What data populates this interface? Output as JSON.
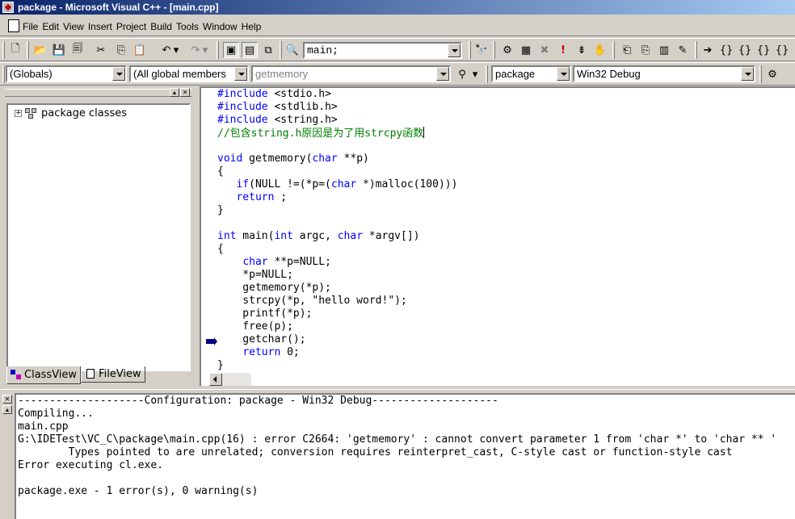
{
  "title": "package - Microsoft Visual C++ - [main.cpp]",
  "menu": [
    "File",
    "Edit",
    "View",
    "Insert",
    "Project",
    "Build",
    "Tools",
    "Window",
    "Help"
  ],
  "toolbar": {
    "find_combo": "main;"
  },
  "wizard_bar": {
    "scope": "(Globals)",
    "members": "(All global members",
    "function": "getmemory",
    "project": "package",
    "config": "Win32 Debug"
  },
  "workspace": {
    "tree_root": "package classes",
    "tabs": [
      "ClassView",
      "FileView"
    ]
  },
  "editor": {
    "lines": [
      [
        {
          "t": "#include",
          "c": "kw"
        },
        {
          "t": " <stdio.h>"
        }
      ],
      [
        {
          "t": "#include",
          "c": "kw"
        },
        {
          "t": " <stdlib.h>"
        }
      ],
      [
        {
          "t": "#include",
          "c": "kw"
        },
        {
          "t": " <string.h>"
        }
      ],
      [
        {
          "t": "//包含string.h原因是为了用strcpy函数",
          "c": "cm"
        }
      ],
      [],
      [
        {
          "t": "void",
          "c": "kw"
        },
        {
          "t": " getmemory("
        },
        {
          "t": "char",
          "c": "kw"
        },
        {
          "t": " **p)"
        }
      ],
      [
        {
          "t": "{"
        }
      ],
      [
        {
          "t": "   "
        },
        {
          "t": "if",
          "c": "kw"
        },
        {
          "t": "(NULL !=(*p=("
        },
        {
          "t": "char",
          "c": "kw"
        },
        {
          "t": " *)malloc(100)))"
        }
      ],
      [
        {
          "t": "   "
        },
        {
          "t": "return",
          "c": "kw"
        },
        {
          "t": " ;"
        }
      ],
      [
        {
          "t": "}"
        }
      ],
      [],
      [
        {
          "t": "int",
          "c": "kw"
        },
        {
          "t": " main("
        },
        {
          "t": "int",
          "c": "kw"
        },
        {
          "t": " argc, "
        },
        {
          "t": "char",
          "c": "kw"
        },
        {
          "t": " *argv[])"
        }
      ],
      [
        {
          "t": "{"
        }
      ],
      [
        {
          "t": "    "
        },
        {
          "t": "char",
          "c": "kw"
        },
        {
          "t": " **p=NULL;"
        }
      ],
      [
        {
          "t": "    *p=NULL;"
        }
      ],
      [
        {
          "t": "    getmemory(*p);"
        }
      ],
      [
        {
          "t": "    strcpy(*p, \"hello word!\");"
        }
      ],
      [
        {
          "t": "    printf(*p);"
        }
      ],
      [
        {
          "t": "    free(p);"
        }
      ],
      [
        {
          "t": "    getchar();"
        }
      ],
      [
        {
          "t": "    "
        },
        {
          "t": "return",
          "c": "kw"
        },
        {
          "t": " 0;"
        }
      ],
      [
        {
          "t": "}"
        }
      ]
    ]
  },
  "output": {
    "lines": [
      "--------------------Configuration: package - Win32 Debug--------------------",
      "Compiling...",
      "main.cpp",
      "G:\\IDETest\\VC_C\\package\\main.cpp(16) : error C2664: 'getmemory' : cannot convert parameter 1 from 'char *' to 'char ** '",
      "        Types pointed to are unrelated; conversion requires reinterpret_cast, C-style cast or function-style cast",
      "Error executing cl.exe.",
      "",
      "package.exe - 1 error(s), 0 warning(s)"
    ]
  },
  "icons": {
    "toolbar1": [
      "new-text-file-icon",
      "open-icon",
      "save-icon",
      "save-all-icon",
      "cut-icon",
      "copy-icon",
      "paste-icon",
      "undo-icon",
      "redo-icon",
      "workspace-icon",
      "output-icon",
      "window-list-icon",
      "find-in-files-icon",
      "find-icon"
    ],
    "toolbar1_right": [
      "compile-icon",
      "build-icon",
      "stop-build-icon",
      "execute-icon",
      "go-icon",
      "insert-breakpoint-icon",
      "remove-breakpoint-icon"
    ]
  }
}
